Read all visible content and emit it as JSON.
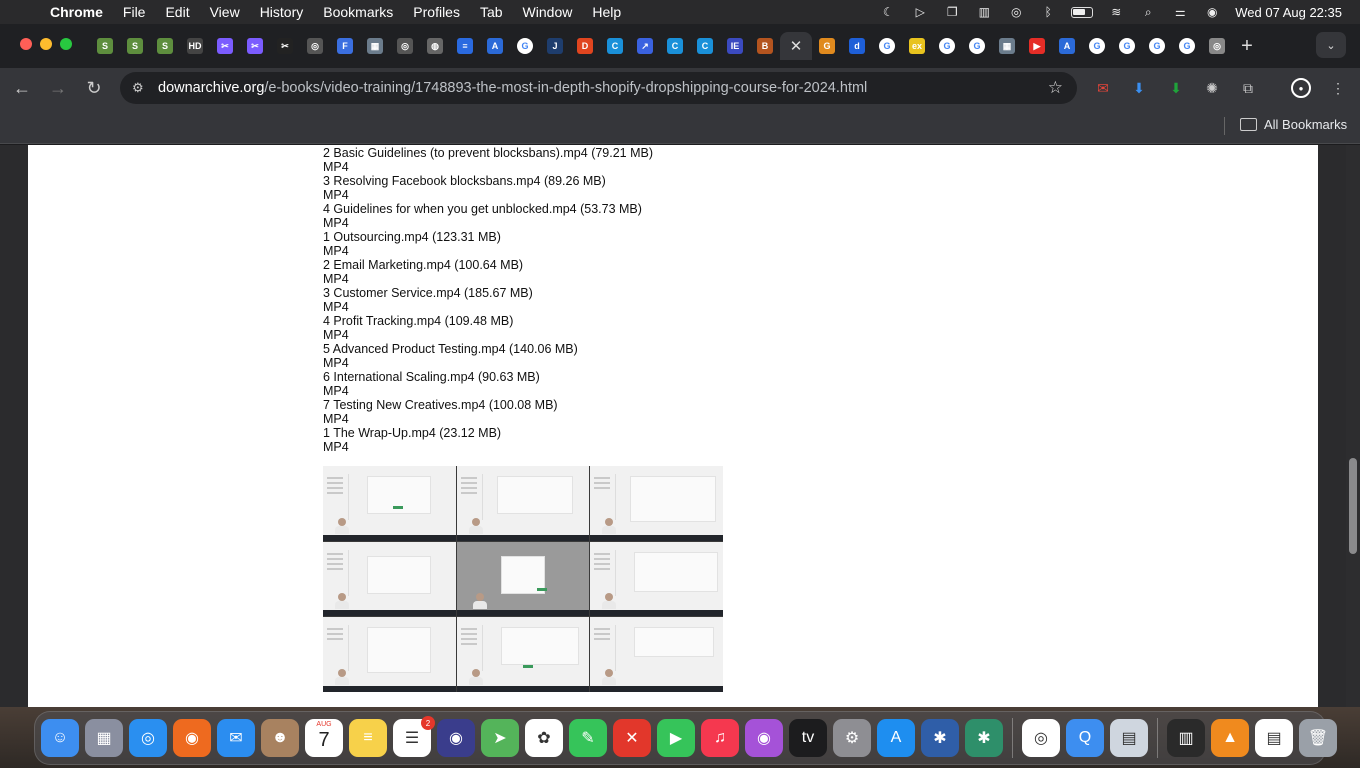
{
  "menubar": {
    "app_name": "Chrome",
    "menus": [
      "File",
      "Edit",
      "View",
      "History",
      "Bookmarks",
      "Profiles",
      "Tab",
      "Window",
      "Help"
    ],
    "clock": "Wed 07 Aug  22:35"
  },
  "tabs": {
    "favicons": [
      {
        "icon": "shopify-icon",
        "color": "#5e8e3e",
        "glyph": "S"
      },
      {
        "icon": "shopify-icon",
        "color": "#5e8e3e",
        "glyph": "S"
      },
      {
        "icon": "shopify-icon",
        "color": "#5e8e3e",
        "glyph": "S"
      },
      {
        "icon": "hdk-icon",
        "color": "#444",
        "glyph": "HD"
      },
      {
        "icon": "capcut-icon",
        "color": "#7b5cff",
        "glyph": "✂"
      },
      {
        "icon": "capcut-icon",
        "color": "#7b5cff",
        "glyph": "✂"
      },
      {
        "icon": "capcut-icon",
        "color": "#222",
        "glyph": "✂"
      },
      {
        "icon": "openai-icon",
        "color": "#555",
        "glyph": "◎"
      },
      {
        "icon": "form-icon",
        "color": "#3b6fe0",
        "glyph": "F"
      },
      {
        "icon": "image-icon",
        "color": "#6b7c8c",
        "glyph": "▦"
      },
      {
        "icon": "openai-icon",
        "color": "#555",
        "glyph": "◎"
      },
      {
        "icon": "globe-icon",
        "color": "#666",
        "glyph": "◍"
      },
      {
        "icon": "docs-icon",
        "color": "#2a6ae0",
        "glyph": "≡"
      },
      {
        "icon": "google-ads-icon",
        "color": "#2b6ad8",
        "glyph": "A"
      },
      {
        "icon": "google-icon",
        "color": "#fff",
        "glyph": "G"
      },
      {
        "icon": "jira-icon",
        "color": "#1e3d6d",
        "glyph": "J"
      },
      {
        "icon": "d-icon",
        "color": "#e0451f",
        "glyph": "D"
      },
      {
        "icon": "canva-icon",
        "color": "#1a90d9",
        "glyph": "C"
      },
      {
        "icon": "arrow-icon",
        "color": "#3a62e0",
        "glyph": "↗"
      },
      {
        "icon": "canva-icon",
        "color": "#1a90d9",
        "glyph": "C"
      },
      {
        "icon": "canva-icon",
        "color": "#1a90d9",
        "glyph": "C"
      },
      {
        "icon": "ie-icon",
        "color": "#3b4ac0",
        "glyph": "IE"
      },
      {
        "icon": "reader-icon",
        "color": "#b4541f",
        "glyph": "B"
      }
    ],
    "active_close": "✕",
    "favicons_after": [
      {
        "icon": "gallery-icon",
        "color": "#e08a1e",
        "glyph": "G"
      },
      {
        "icon": "d-icon",
        "color": "#1e5fd8",
        "glyph": "d"
      },
      {
        "icon": "google-icon",
        "color": "#fff",
        "glyph": "G"
      },
      {
        "icon": "ex-icon",
        "color": "#e8c31e",
        "glyph": "ex"
      },
      {
        "icon": "google-icon",
        "color": "#fff",
        "glyph": "G"
      },
      {
        "icon": "google-icon",
        "color": "#fff",
        "glyph": "G"
      },
      {
        "icon": "image-icon",
        "color": "#6b7c8c",
        "glyph": "▦"
      },
      {
        "icon": "youtube-icon",
        "color": "#e52d27",
        "glyph": "▶"
      },
      {
        "icon": "google-ads-icon",
        "color": "#2b6ad8",
        "glyph": "A"
      },
      {
        "icon": "google-icon",
        "color": "#fff",
        "glyph": "G"
      },
      {
        "icon": "google-icon",
        "color": "#fff",
        "glyph": "G"
      },
      {
        "icon": "google-icon",
        "color": "#fff",
        "glyph": "G"
      },
      {
        "icon": "google-icon",
        "color": "#fff",
        "glyph": "G"
      },
      {
        "icon": "chrome-icon",
        "color": "#888",
        "glyph": "◎"
      }
    ],
    "new_tab": "+"
  },
  "toolbar": {
    "url_host": "downarchive.org",
    "url_path": "/e-books/video-training/1748893-the-most-in-depth-shopify-dropshipping-course-for-2024.html"
  },
  "bookmarks": {
    "all_label": "All Bookmarks"
  },
  "page": {
    "lines": [
      "2 Basic Guidelines (to prevent blocksbans).mp4 (79.21 MB)",
      "MP4",
      "3 Resolving Facebook blocksbans.mp4 (89.26 MB)",
      "MP4",
      "4 Guidelines for when you get unblocked.mp4 (53.73 MB)",
      "MP4",
      "1 Outsourcing.mp4 (123.31 MB)",
      "MP4",
      "2 Email Marketing.mp4 (100.64 MB)",
      "MP4",
      "3 Customer Service.mp4 (185.67 MB)",
      "MP4",
      "4 Profit Tracking.mp4 (109.48 MB)",
      "MP4",
      "5 Advanced Product Testing.mp4 (140.06 MB)",
      "MP4",
      "6 International Scaling.mp4 (90.63 MB)",
      "MP4",
      "7 Testing New Creatives.mp4 (100.08 MB)",
      "MP4",
      "1 The Wrap-Up.mp4 (23.12 MB)",
      "MP4"
    ]
  },
  "dock": {
    "calendar_month": "AUG",
    "calendar_day": "7",
    "reminders_badge": "2",
    "apps": [
      {
        "name": "finder",
        "color": "#3d8ef0",
        "glyph": "☺"
      },
      {
        "name": "launchpad",
        "color": "#8a8fa0",
        "glyph": "▦"
      },
      {
        "name": "safari",
        "color": "#2a8ff0",
        "glyph": "◎"
      },
      {
        "name": "firefox",
        "color": "#ee6a1f",
        "glyph": "◉"
      },
      {
        "name": "mail",
        "color": "#2b8df0",
        "glyph": "✉"
      },
      {
        "name": "contacts",
        "color": "#a88260",
        "glyph": "☻"
      },
      {
        "name": "calendar",
        "color": "#ffffff",
        "glyph": ""
      },
      {
        "name": "notes",
        "color": "#f7d14a",
        "glyph": "≡"
      },
      {
        "name": "reminders",
        "color": "#ffffff",
        "glyph": "☰"
      },
      {
        "name": "siri",
        "color": "#3a3d8c",
        "glyph": "◉"
      },
      {
        "name": "maps",
        "color": "#54b45a",
        "glyph": "➤"
      },
      {
        "name": "photos",
        "color": "#ffffff",
        "glyph": "✿"
      },
      {
        "name": "messages",
        "color": "#36c45a",
        "glyph": "✎"
      },
      {
        "name": "xmind",
        "color": "#e2372b",
        "glyph": "✕"
      },
      {
        "name": "facetime",
        "color": "#36c45a",
        "glyph": "▶"
      },
      {
        "name": "music",
        "color": "#f5384f",
        "glyph": "♫"
      },
      {
        "name": "podcasts",
        "color": "#a552d8",
        "glyph": "◉"
      },
      {
        "name": "apple-tv",
        "color": "#1c1c1e",
        "glyph": "tv"
      },
      {
        "name": "system-settings",
        "color": "#8e8e93",
        "glyph": "⚙"
      },
      {
        "name": "app-store",
        "color": "#1e8ef0",
        "glyph": "A"
      },
      {
        "name": "audio-app",
        "color": "#2f5ea8",
        "glyph": "✱"
      },
      {
        "name": "chatgpt-dock",
        "color": "#2e8f6a",
        "glyph": "✱"
      }
    ],
    "apps_after": [
      {
        "name": "chrome",
        "color": "#ffffff",
        "glyph": "◎"
      },
      {
        "name": "quicktime",
        "color": "#3d8ef0",
        "glyph": "Q"
      },
      {
        "name": "preview",
        "color": "#cfd6df",
        "glyph": "▤"
      }
    ],
    "apps_end": [
      {
        "name": "downloads-stack",
        "color": "#2a2a2a",
        "glyph": "▥"
      },
      {
        "name": "vlc",
        "color": "#f08a1e",
        "glyph": "▲"
      },
      {
        "name": "documents-stack",
        "color": "#ffffff",
        "glyph": "▤"
      },
      {
        "name": "trash",
        "color": "#9aa0a8",
        "glyph": "🗑"
      }
    ]
  },
  "colors": {
    "page_background": "#ffffff",
    "text": "#111111",
    "toolbar": "#35363a"
  }
}
